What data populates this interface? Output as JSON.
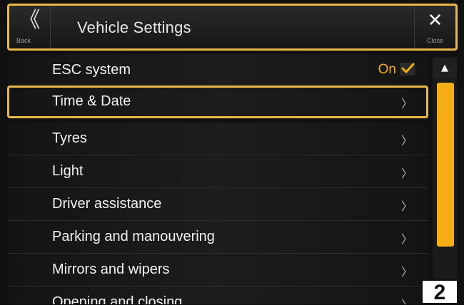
{
  "header": {
    "back_glyph": "《",
    "back_label": "Back",
    "title": "Vehicle Settings",
    "close_glyph": "✕",
    "close_label": "Close"
  },
  "rows": [
    {
      "label": "ESC system",
      "state": "On",
      "checked": true
    },
    {
      "label": "Time & Date",
      "chevron": "〉"
    },
    {
      "label": "Tyres",
      "chevron": "〉"
    },
    {
      "label": "Light",
      "chevron": "〉"
    },
    {
      "label": "Driver assistance",
      "chevron": "〉"
    },
    {
      "label": "Parking and manouvering",
      "chevron": "〉"
    },
    {
      "label": "Mirrors and wipers",
      "chevron": "〉"
    },
    {
      "label": "Opening and closing",
      "chevron": "〉"
    }
  ],
  "scrollbar": {
    "up_glyph": "▲"
  },
  "page_number": "2",
  "colors": {
    "accent": "#f5ae16",
    "highlight_border": "#e9b84a"
  }
}
